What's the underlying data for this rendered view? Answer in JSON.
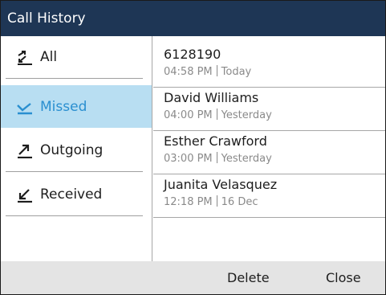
{
  "title": "Call History",
  "filters": [
    {
      "label": "All",
      "icon": "all-calls-icon"
    },
    {
      "label": "Missed",
      "icon": "missed-call-icon"
    },
    {
      "label": "Outgoing",
      "icon": "outgoing-call-icon"
    },
    {
      "label": "Received",
      "icon": "received-call-icon"
    }
  ],
  "selected_filter": "Missed",
  "calls": [
    {
      "name": "6128190",
      "time": "04:58 PM",
      "date": "Today"
    },
    {
      "name": "David Williams",
      "time": "04:00 PM",
      "date": "Yesterday"
    },
    {
      "name": "Esther Crawford",
      "time": "03:00 PM",
      "date": "Yesterday"
    },
    {
      "name": "Juanita Velasquez",
      "time": "12:18 PM",
      "date": "16 Dec"
    }
  ],
  "softkeys": {
    "delete": "Delete",
    "close": "Close"
  },
  "colors": {
    "titlebar": "#1e3655",
    "selected_bg": "#b8def2",
    "selected_text": "#2a8fd0",
    "softkey_bar": "#e4e4e4"
  }
}
